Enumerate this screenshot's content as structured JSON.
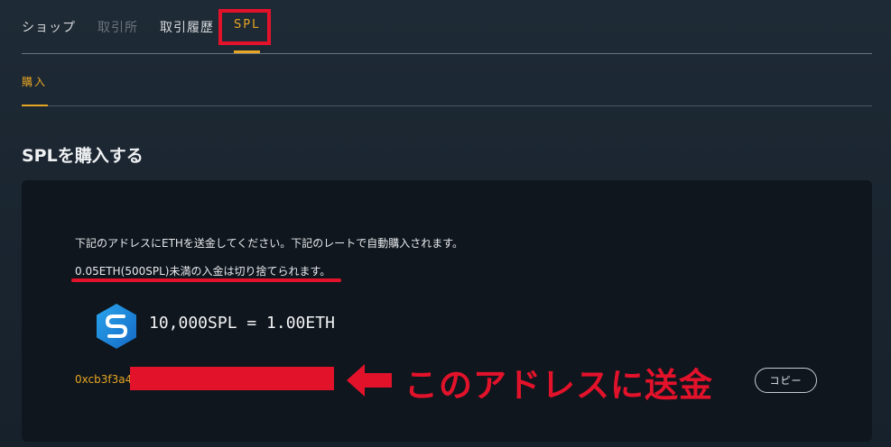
{
  "tabs": {
    "shop": "ショップ",
    "exchange": "取引所",
    "history": "取引履歴",
    "spl": "SPL"
  },
  "subtabs": {
    "buy": "購入"
  },
  "section": {
    "title": "SPLを購入する"
  },
  "panel": {
    "notice": "下記のアドレスにETHを送金してください。下記のレートで自動購入されます。",
    "warning": "0.05ETH(500SPL)未満の入金は切り捨てられます。",
    "rate": "10,000SPL = 1.00ETH",
    "address_prefix": "0xcb3f3a4",
    "callout": "このアドレスに送金",
    "copy_label": "コピー"
  },
  "colors": {
    "accent": "#e8a623",
    "annotation_red": "#e3122b",
    "panel_bg": "#0f161d",
    "logo_blue": "#1a8fe0"
  },
  "icons": {
    "token": "spl-token-icon",
    "arrow": "left-arrow-icon"
  }
}
